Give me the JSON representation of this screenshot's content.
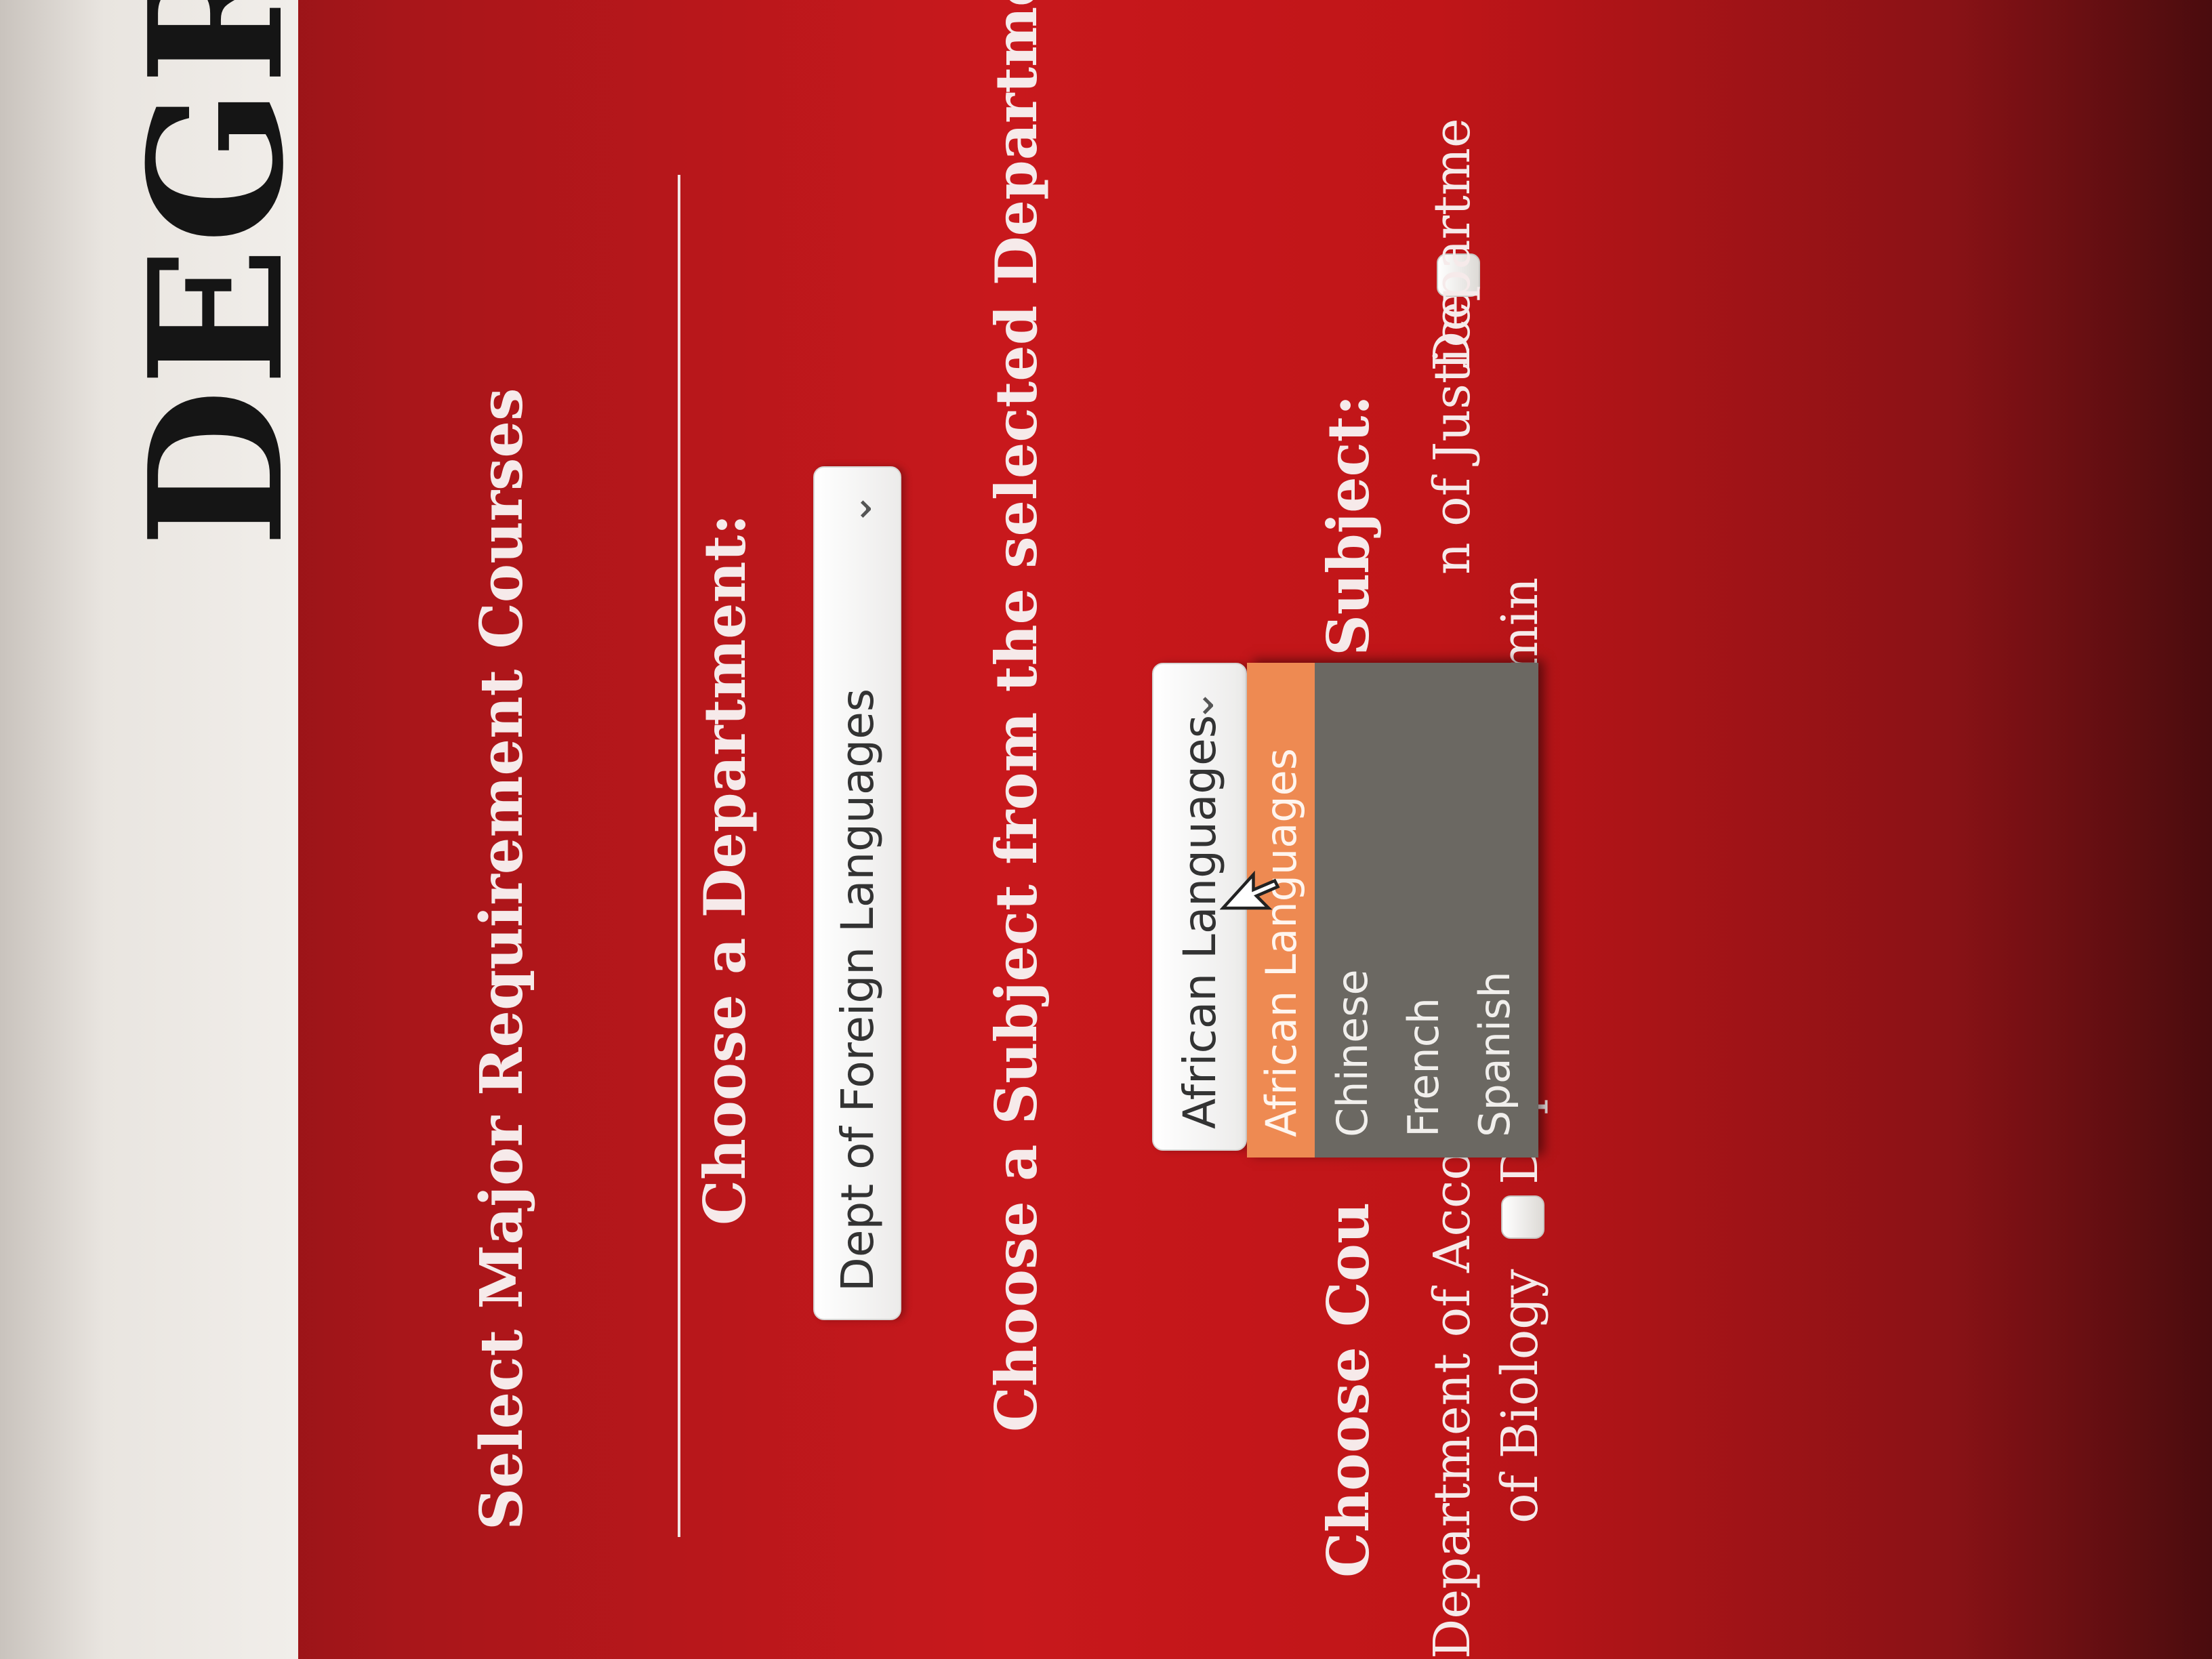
{
  "header": {
    "title": "DEGRI"
  },
  "section": {
    "title": "Select Major Requirement Courses"
  },
  "department": {
    "label": "Choose a Department:",
    "selected": "Dept of Foreign Languages"
  },
  "subject": {
    "label": "Choose a Subject from the selected Department:",
    "selected": "African Languages",
    "options": [
      "African Languages",
      "Chinese",
      "French",
      "Spanish"
    ],
    "highlighted_option": "African Languages"
  },
  "courses": {
    "label_start": "Choose Cou",
    "label_end": "ted Subject:"
  },
  "department_checkboxes": {
    "row1_start": "Department of Account",
    "row1_mid": "n of Justice",
    "row1_end": "Departme",
    "row2_start": "of Biology",
    "row2_end": "Dept of Business Admin"
  },
  "colors": {
    "background_red": "#c8181c",
    "header_band": "#f1eeea",
    "highlight_orange": "#ee8a52",
    "dropdown_gray": "#6b6862"
  },
  "icons": {
    "select_chevron": "chevron-down-icon",
    "cursor": "mouse-pointer-icon"
  }
}
